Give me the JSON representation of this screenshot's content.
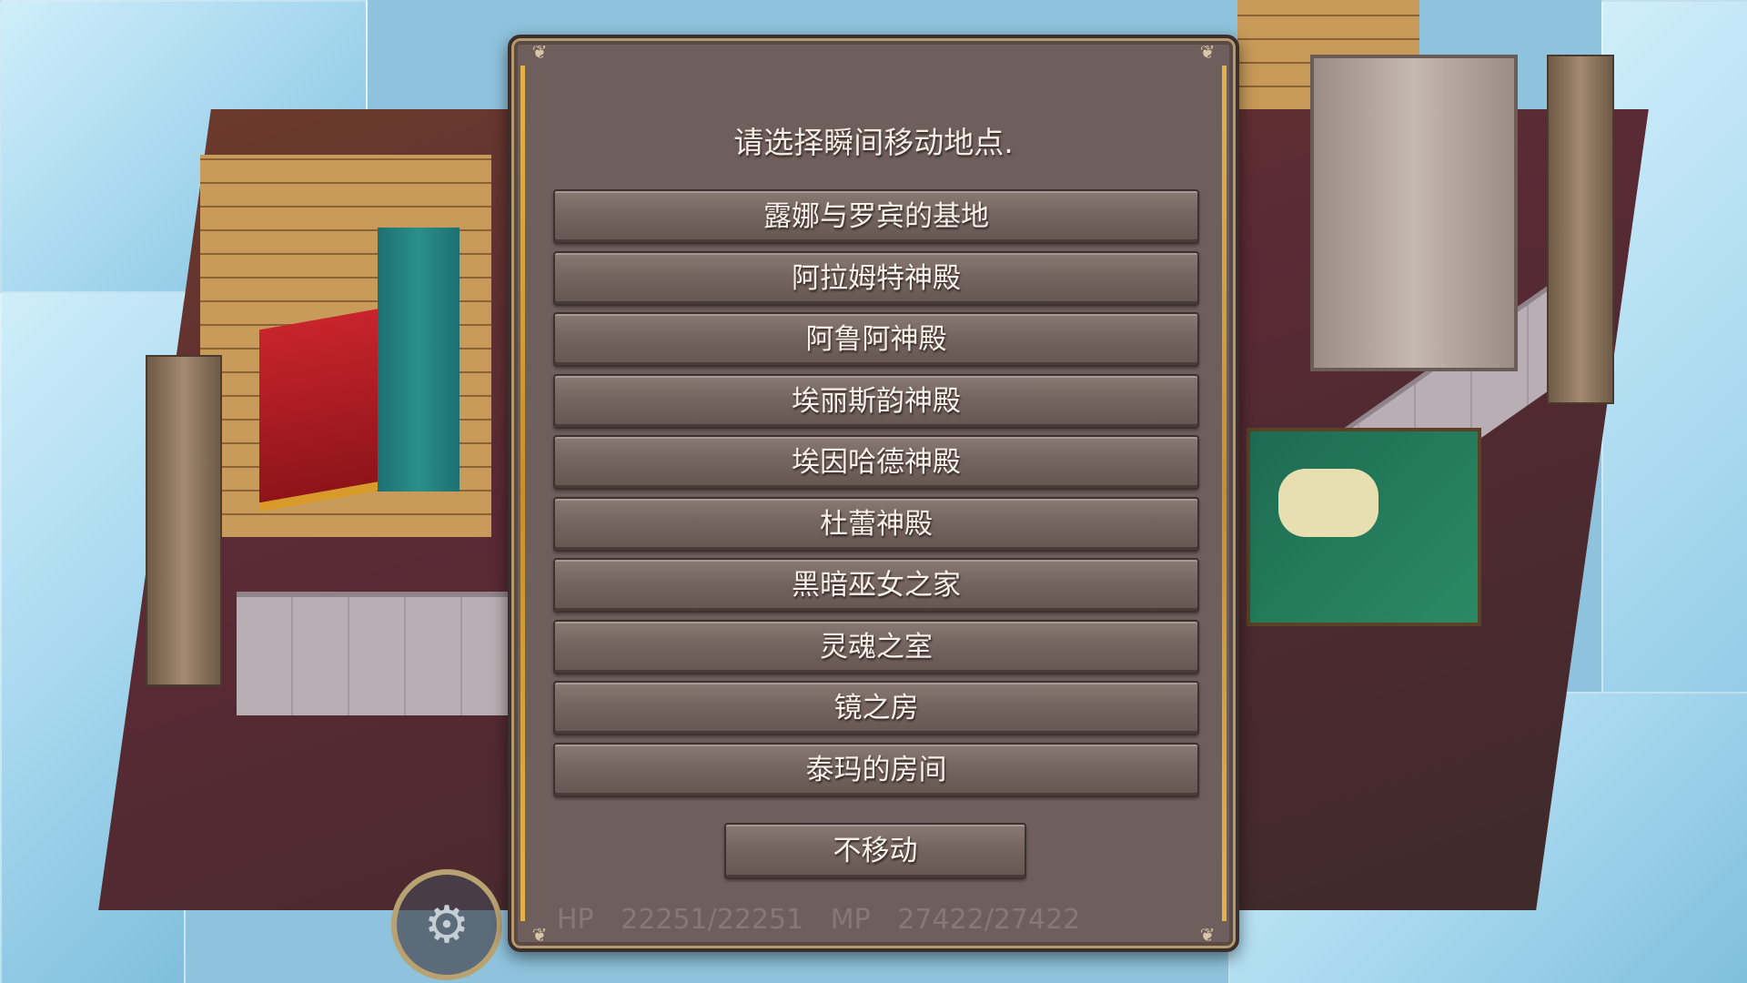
{
  "dialog": {
    "prompt": "请选择瞬间移动地点.",
    "destinations": [
      "露娜与罗宾的基地",
      "阿拉姆特神殿",
      "阿鲁阿神殿",
      "埃丽斯韵神殿",
      "埃因哈德神殿",
      "杜蕾神殿",
      "黑暗巫女之家",
      "灵魂之室",
      "镜之房",
      "泰玛的房间"
    ],
    "cancel_label": "不移动"
  },
  "status": {
    "hp_label": "HP",
    "hp_value": "22251/22251",
    "mp_label": "MP",
    "mp_value": "27422/27422"
  },
  "icons": {
    "settings": "gears-icon"
  },
  "colors": {
    "dialog_bg": "#6e5f5c",
    "button_bg": "#746560",
    "gold_trim": "#e2b24a",
    "text": "#f6f0e8"
  }
}
